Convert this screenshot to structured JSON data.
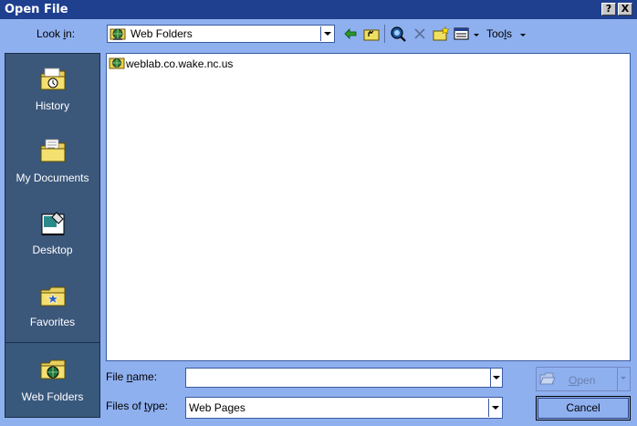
{
  "window": {
    "title": "Open File",
    "help_glyph": "?",
    "close_glyph": "X"
  },
  "lookin": {
    "label_pre": "Look ",
    "label_key": "i",
    "label_post": "n:",
    "value": "Web Folders"
  },
  "toolbar": {
    "tools_pre": "Too",
    "tools_key": "l",
    "tools_post": "s"
  },
  "places": [
    {
      "label": "History"
    },
    {
      "label": "My Documents"
    },
    {
      "label": "Desktop"
    },
    {
      "label": "Favorites"
    },
    {
      "label": "Web Folders"
    }
  ],
  "files": [
    {
      "name": "weblab.co.wake.nc.us"
    }
  ],
  "filename": {
    "label_pre": "File ",
    "label_key": "n",
    "label_post": "ame:",
    "value": ""
  },
  "filetype": {
    "label_pre": "Files of ",
    "label_key": "t",
    "label_post": "ype:",
    "value": "Web Pages"
  },
  "buttons": {
    "open_pre": "",
    "open_key": "O",
    "open_post": "pen",
    "cancel": "Cancel"
  },
  "colors": {
    "dialog_bg": "#8fb0ef",
    "titlebar": "#1f3f8f",
    "places_bg": "#3b577a"
  }
}
